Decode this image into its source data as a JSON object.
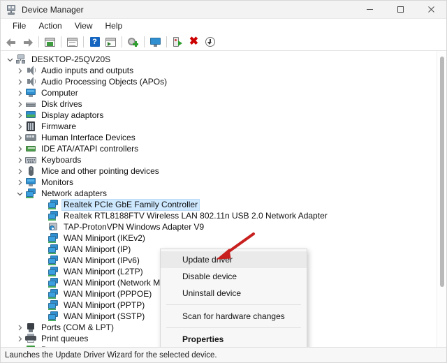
{
  "window": {
    "title": "Device Manager",
    "icon": "device-manager-icon",
    "controls": {
      "minimize": "Minimize",
      "maximize": "Maximize",
      "close": "Close"
    }
  },
  "menubar": {
    "items": [
      {
        "label": "File"
      },
      {
        "label": "Action"
      },
      {
        "label": "View"
      },
      {
        "label": "Help"
      }
    ]
  },
  "toolbar": {
    "buttons": [
      {
        "name": "back-button",
        "icon": "back-arrow-icon"
      },
      {
        "name": "forward-button",
        "icon": "forward-arrow-icon"
      },
      {
        "name": "show-hide-console-tree-button",
        "icon": "console-tree-icon"
      },
      {
        "name": "properties-button",
        "icon": "properties-window-icon"
      },
      {
        "name": "help-button",
        "icon": "help-question-icon"
      },
      {
        "name": "show-hide-action-pane-button",
        "icon": "action-pane-icon"
      },
      {
        "name": "update-driver-button",
        "icon": "update-driver-gear-icon"
      },
      {
        "name": "scan-for-hardware-changes-button",
        "icon": "scan-monitor-icon"
      },
      {
        "name": "enable-device-button",
        "icon": "enable-device-icon"
      },
      {
        "name": "uninstall-device-button",
        "icon": "uninstall-x-icon"
      },
      {
        "name": "disable-device-button",
        "icon": "disable-down-arrow-icon"
      }
    ]
  },
  "tree": {
    "root": {
      "label": "DESKTOP-25QV20S",
      "icon": "computer-root-icon",
      "expanded": true,
      "depth": 0
    },
    "items": [
      {
        "label": "Audio inputs and outputs",
        "icon": "speaker-icon",
        "depth": 1,
        "expanded": false,
        "selected": false
      },
      {
        "label": "Audio Processing Objects (APOs)",
        "icon": "speaker-icon",
        "depth": 1,
        "expanded": false,
        "selected": false
      },
      {
        "label": "Computer",
        "icon": "monitor-icon",
        "depth": 1,
        "expanded": false,
        "selected": false
      },
      {
        "label": "Disk drives",
        "icon": "disk-drive-icon",
        "depth": 1,
        "expanded": false,
        "selected": false
      },
      {
        "label": "Display adaptors",
        "icon": "display-adapter-icon",
        "depth": 1,
        "expanded": false,
        "selected": false
      },
      {
        "label": "Firmware",
        "icon": "firmware-icon",
        "depth": 1,
        "expanded": false,
        "selected": false
      },
      {
        "label": "Human Interface Devices",
        "icon": "hid-icon",
        "depth": 1,
        "expanded": false,
        "selected": false
      },
      {
        "label": "IDE ATA/ATAPI controllers",
        "icon": "ide-controller-icon",
        "depth": 1,
        "expanded": false,
        "selected": false
      },
      {
        "label": "Keyboards",
        "icon": "keyboard-icon",
        "depth": 1,
        "expanded": false,
        "selected": false
      },
      {
        "label": "Mice and other pointing devices",
        "icon": "mouse-icon",
        "depth": 1,
        "expanded": false,
        "selected": false
      },
      {
        "label": "Monitors",
        "icon": "monitor-icon",
        "depth": 1,
        "expanded": false,
        "selected": false
      },
      {
        "label": "Network adapters",
        "icon": "network-adapter-icon",
        "depth": 1,
        "expanded": true,
        "selected": false
      },
      {
        "label": "Realtek PCIe GbE Family Controller",
        "icon": "network-adapter-icon",
        "depth": 2,
        "expanded": null,
        "selected": true
      },
      {
        "label": "Realtek RTL8188FTV Wireless LAN 802.11n USB 2.0 Network Adapter",
        "icon": "network-adapter-icon",
        "depth": 2,
        "expanded": null,
        "selected": false
      },
      {
        "label": "TAP-ProtonVPN Windows Adapter V9",
        "icon": "tap-adapter-icon",
        "depth": 2,
        "expanded": null,
        "selected": false
      },
      {
        "label": "WAN Miniport (IKEv2)",
        "icon": "network-adapter-icon",
        "depth": 2,
        "expanded": null,
        "selected": false
      },
      {
        "label": "WAN Miniport (IP)",
        "icon": "network-adapter-icon",
        "depth": 2,
        "expanded": null,
        "selected": false
      },
      {
        "label": "WAN Miniport (IPv6)",
        "icon": "network-adapter-icon",
        "depth": 2,
        "expanded": null,
        "selected": false
      },
      {
        "label": "WAN Miniport (L2TP)",
        "icon": "network-adapter-icon",
        "depth": 2,
        "expanded": null,
        "selected": false
      },
      {
        "label": "WAN Miniport (Network Monitor)",
        "icon": "network-adapter-icon",
        "depth": 2,
        "expanded": null,
        "selected": false
      },
      {
        "label": "WAN Miniport (PPPOE)",
        "icon": "network-adapter-icon",
        "depth": 2,
        "expanded": null,
        "selected": false
      },
      {
        "label": "WAN Miniport (PPTP)",
        "icon": "network-adapter-icon",
        "depth": 2,
        "expanded": null,
        "selected": false
      },
      {
        "label": "WAN Miniport (SSTP)",
        "icon": "network-adapter-icon",
        "depth": 2,
        "expanded": null,
        "selected": false
      },
      {
        "label": "Ports (COM & LPT)",
        "icon": "port-icon",
        "depth": 1,
        "expanded": false,
        "selected": false
      },
      {
        "label": "Print queues",
        "icon": "printer-icon",
        "depth": 1,
        "expanded": false,
        "selected": false
      },
      {
        "label": "Processors",
        "icon": "processor-icon",
        "depth": 1,
        "expanded": false,
        "selected": false
      }
    ]
  },
  "context_menu": {
    "items": [
      {
        "label": "Update driver",
        "type": "item",
        "highlighted": true,
        "bold": false
      },
      {
        "label": "Disable device",
        "type": "item",
        "highlighted": false,
        "bold": false
      },
      {
        "label": "Uninstall device",
        "type": "item",
        "highlighted": false,
        "bold": false
      },
      {
        "type": "separator"
      },
      {
        "label": "Scan for hardware changes",
        "type": "item",
        "highlighted": false,
        "bold": false
      },
      {
        "type": "separator"
      },
      {
        "label": "Properties",
        "type": "item",
        "highlighted": false,
        "bold": true
      }
    ]
  },
  "annotation": {
    "type": "red-arrow",
    "color": "#c8201f",
    "points_to": "Update driver"
  },
  "statusbar": {
    "text": "Launches the Update Driver Wizard for the selected device."
  },
  "colors": {
    "selection": "#cde8ff",
    "titlebar_bg": "#f3f3f3",
    "menu_bg": "#f7f7f7",
    "annotation_red": "#c8201f"
  }
}
